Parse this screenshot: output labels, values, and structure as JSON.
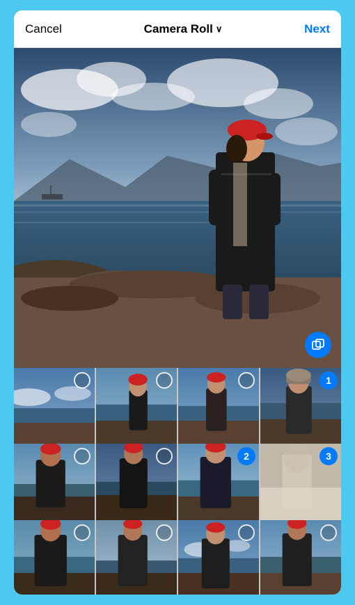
{
  "header": {
    "cancel_label": "Cancel",
    "title_label": "Camera Roll",
    "next_label": "Next"
  },
  "thumbnails": [
    {
      "id": 1,
      "row": 1,
      "col": 1,
      "selected": false,
      "badge": null,
      "scene": "beach_wide"
    },
    {
      "id": 2,
      "row": 1,
      "col": 2,
      "selected": false,
      "badge": null,
      "scene": "person_coast"
    },
    {
      "id": 3,
      "row": 1,
      "col": 3,
      "selected": false,
      "badge": null,
      "scene": "person_coast2"
    },
    {
      "id": 4,
      "row": 1,
      "col": 4,
      "selected": true,
      "badge": "1",
      "scene": "person_scarf"
    },
    {
      "id": 5,
      "row": 2,
      "col": 1,
      "selected": false,
      "badge": null,
      "scene": "person_red_hat"
    },
    {
      "id": 6,
      "row": 2,
      "col": 2,
      "selected": false,
      "badge": null,
      "scene": "person_dark"
    },
    {
      "id": 7,
      "row": 2,
      "col": 3,
      "selected": true,
      "badge": "2",
      "scene": "person_hat_side"
    },
    {
      "id": 8,
      "row": 2,
      "col": 4,
      "selected": true,
      "badge": "3",
      "scene": "person_light"
    },
    {
      "id": 9,
      "row": 3,
      "col": 1,
      "selected": false,
      "badge": null,
      "scene": "person_red2"
    },
    {
      "id": 10,
      "row": 3,
      "col": 2,
      "selected": false,
      "badge": null,
      "scene": "person_dark2"
    },
    {
      "id": 11,
      "row": 3,
      "col": 3,
      "selected": false,
      "badge": null,
      "scene": "person_coast3"
    },
    {
      "id": 12,
      "row": 3,
      "col": 4,
      "selected": false,
      "badge": null,
      "scene": "person_hat2"
    }
  ],
  "colors": {
    "accent": "#007aff",
    "sky_top": "#3a6b9e",
    "sky_bottom": "#b8c8d8",
    "water": "#4a7090",
    "rocks": "#5a4a3a",
    "sand": "#8a7060"
  }
}
